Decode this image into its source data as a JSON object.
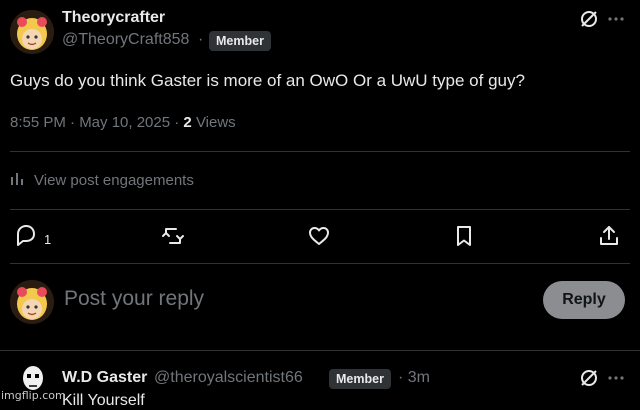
{
  "post": {
    "author_name": "Theorycrafter",
    "author_handle": "@TheoryCraft858",
    "separator": "·",
    "badge": "Member",
    "text": "Guys do you think Gaster is more of an OwO Or a UwU type of guy?",
    "timestamp": "8:55 PM · May 10, 2025 ·",
    "views_count": "2",
    "views_label": "Views",
    "engagements_label": "View post engagements",
    "reply_count": "1"
  },
  "composer": {
    "placeholder": "Post your reply",
    "reply_button": "Reply"
  },
  "reply": {
    "author_name": "W.D Gaster",
    "author_handle": "@theroyalscientist66",
    "badge": "Member",
    "time": "· 3m",
    "text": "Kill Yourself"
  },
  "watermark": "imgflip.com",
  "icons": {
    "grok": "grok-icon",
    "more": "more-icon",
    "reply": "reply-icon",
    "repost": "repost-icon",
    "like": "heart-icon",
    "bookmark": "bookmark-icon",
    "share": "share-icon",
    "analytics": "analytics-icon"
  },
  "colors": {
    "background": "#000000",
    "text": "#e7e9ea",
    "muted": "#71767b",
    "divider": "#2f3336",
    "reply_button": "#8b8d90"
  }
}
